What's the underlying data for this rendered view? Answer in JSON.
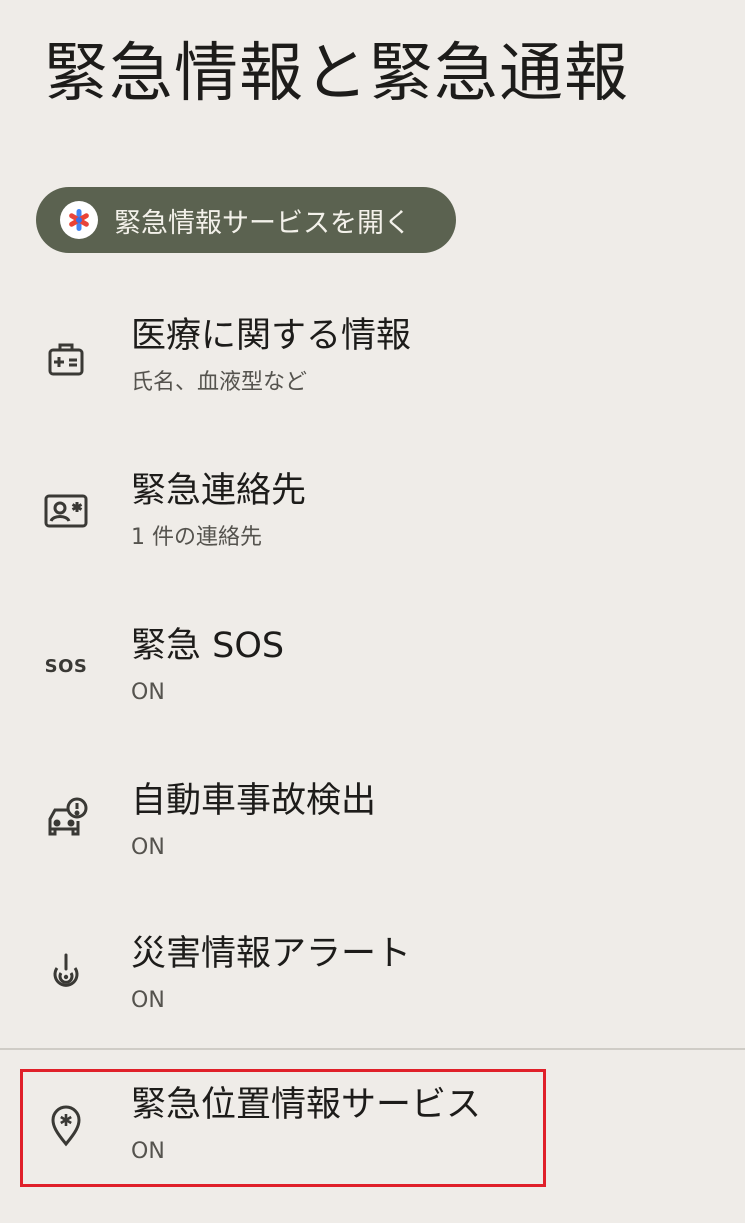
{
  "page": {
    "title": "緊急情報と緊急通報"
  },
  "open_button": {
    "label": "緊急情報サービスを開く"
  },
  "items": [
    {
      "icon": "medical-id-icon",
      "title": "医療に関する情報",
      "summary": "氏名、血液型など"
    },
    {
      "icon": "contact-card-icon",
      "title": "緊急連絡先",
      "summary": "1 件の連絡先"
    },
    {
      "icon": "sos-icon",
      "icon_text": "SOS",
      "title": "緊急 SOS",
      "summary": "ON"
    },
    {
      "icon": "car-crash-icon",
      "title": "自動車事故検出",
      "summary": "ON"
    },
    {
      "icon": "crisis-alert-icon",
      "title": "災害情報アラート",
      "summary": "ON"
    },
    {
      "icon": "emergency-location-icon",
      "title": "緊急位置情報サービス",
      "summary": "ON"
    }
  ],
  "colors": {
    "background": "#efece8",
    "button_bg": "#5b6250",
    "highlight": "#e0202a"
  }
}
